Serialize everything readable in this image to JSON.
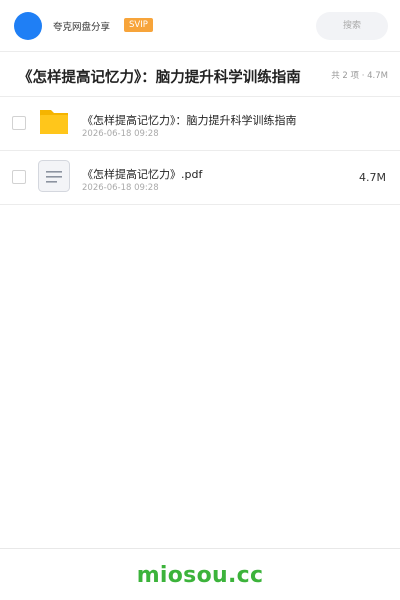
{
  "header": {
    "owner_name": "夸克网盘分享",
    "badge": "SVIP",
    "search_placeholder": "搜索"
  },
  "folder": {
    "title": "《怎样提高记忆力》：脑力提升科学训练指南",
    "summary": "共 2 项 · 4.7M"
  },
  "files": [
    {
      "type": "folder",
      "icon": "folder-icon",
      "name": "《怎样提高记忆力》：脑力提升科学训练指南",
      "date": "2026-06-18 09:28",
      "size": ""
    },
    {
      "type": "pdf",
      "icon": "document-icon",
      "name": "《怎样提高记忆力》.pdf",
      "date": "2026-06-18 09:28",
      "size": "4.7M"
    }
  ],
  "footer": {
    "brand": "miosou.cc"
  },
  "colors": {
    "accent": "#1f7ff5",
    "badge": "#f7a43a",
    "folder": "#ffc61b",
    "brand": "#3cb33b"
  }
}
